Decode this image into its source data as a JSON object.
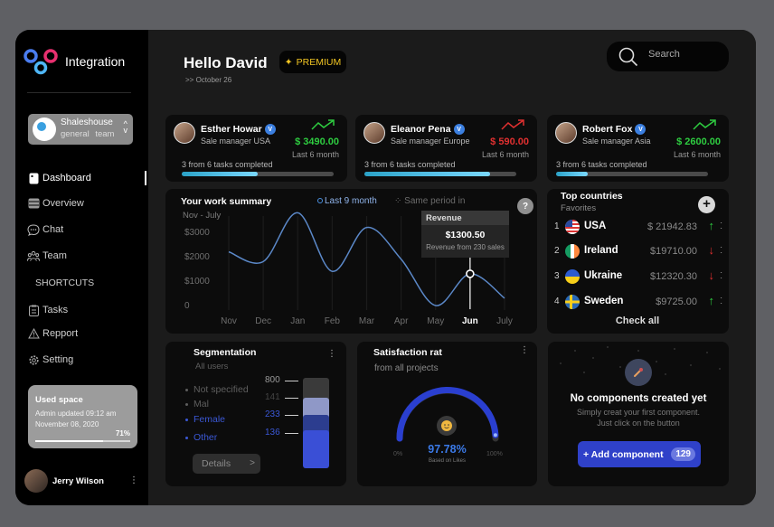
{
  "app": {
    "name": "Integration"
  },
  "workspace": {
    "name": "Shaleshouse",
    "sub": "general team"
  },
  "nav": [
    {
      "label": "Dashboard",
      "icon": "dashboard-icon",
      "active": true
    },
    {
      "label": "Overview",
      "icon": "overview-icon"
    },
    {
      "label": "Chat",
      "icon": "chat-icon"
    },
    {
      "label": "Team",
      "icon": "team-icon"
    }
  ],
  "shortcuts_label": "SHORTCUTS",
  "shortcuts": [
    {
      "label": "Tasks",
      "icon": "tasks-icon"
    },
    {
      "label": "Repport",
      "icon": "report-icon"
    },
    {
      "label": "Setting",
      "icon": "gear-icon"
    }
  ],
  "used_space": {
    "title": "Used space",
    "line1": "Admin updated 09:12 am",
    "line2": "November 08, 2020",
    "percent_label": "71%",
    "percent": 71
  },
  "user": {
    "name": "Jerry Wilson"
  },
  "header": {
    "greeting": "Hello David",
    "date": ">> October 26",
    "premium": "PREMIUM",
    "search_placeholder": "Search"
  },
  "people": [
    {
      "name": "Esther Howar",
      "role": "Sale manager USA",
      "amount": "$ 3490.00",
      "trend": "up",
      "color": "#2ecc40",
      "period": "Last 6 month",
      "tasks": "3 from 6 tasks completed",
      "progress": 0.5
    },
    {
      "name": "Eleanor Pena",
      "role": "Sale manager Europe",
      "amount": "$ 590.00",
      "trend": "up",
      "color": "#e03030",
      "period": "Last 6 month",
      "tasks": "3 from 6 tasks completed",
      "progress": 0.83
    },
    {
      "name": "Robert Fox",
      "role": "Sale manager Asia",
      "amount": "$ 2600.00",
      "trend": "up",
      "color": "#2ecc40",
      "period": "Last 6 month",
      "tasks": "3 from 6 tasks completed",
      "progress": 0.21
    }
  ],
  "work_summary": {
    "title": "Your work summary",
    "subtitle": "Nov - July",
    "legend_a": "Last 9 month",
    "legend_b": "Same period in",
    "help": "?",
    "tooltip": {
      "title": "Revenue",
      "value": "$1300.50",
      "sub": "Revenue from 230 sales"
    }
  },
  "chart_data": {
    "type": "line",
    "x": [
      "Nov",
      "Dec",
      "Jan",
      "Feb",
      "Mar",
      "Apr",
      "May",
      "Jun",
      "July"
    ],
    "ytick_labels": [
      "0",
      "$1000",
      "$2000",
      "$3000"
    ],
    "ylim": [
      0,
      3000
    ],
    "highlight": "Jun",
    "series": [
      {
        "values": [
          2200,
          1800,
          3800,
          1400,
          3200,
          1900,
          0,
          1300,
          300
        ]
      }
    ]
  },
  "countries": {
    "title": "Top countries",
    "subtitle": "Favorites",
    "add": "+",
    "rows": [
      {
        "rank": "1",
        "name": "USA",
        "value": "$ 21942.83",
        "trend": "up",
        "flag": "us"
      },
      {
        "rank": "2",
        "name": "Ireland",
        "value": "$19710.00",
        "trend": "down",
        "flag": "ie"
      },
      {
        "rank": "3",
        "name": "Ukraine",
        "value": "$12320.30",
        "trend": "down",
        "flag": "ua"
      },
      {
        "rank": "4",
        "name": "Sweden",
        "value": "$9725.00",
        "trend": "up",
        "flag": "se"
      }
    ],
    "check_all": "Check all"
  },
  "segmentation": {
    "title": "Segmentation",
    "subtitle": "All users",
    "items": [
      {
        "label": "Not specified",
        "value": "800",
        "color": "#777777",
        "num_color": "#9a9a9a"
      },
      {
        "label": "Mal",
        "value": "141",
        "color": "#777777",
        "num_color": "#444444"
      },
      {
        "label": "Female",
        "value": "233",
        "color": "#3b58d6",
        "num_color": "#3b58d6"
      },
      {
        "label": "Other",
        "value": "136",
        "color": "#3b58d6",
        "num_color": "#3b58d6"
      }
    ],
    "details": "Details",
    "details_chev": ">"
  },
  "satisfaction": {
    "title": "Satisfaction rat",
    "subtitle": "from all projects",
    "percent": "97.78%",
    "value": 97.78,
    "note": "Based on Likes",
    "min": "0%",
    "max": "100%"
  },
  "components": {
    "title": "No components created yet",
    "line1": "Simply creat your first component.",
    "line2": "Just click on the button",
    "button": "+ Add component",
    "count": "129"
  },
  "colors": {
    "accent": "#2f41c9",
    "up": "#2ecc40",
    "down": "#e03030",
    "premium": "#f3c623"
  }
}
